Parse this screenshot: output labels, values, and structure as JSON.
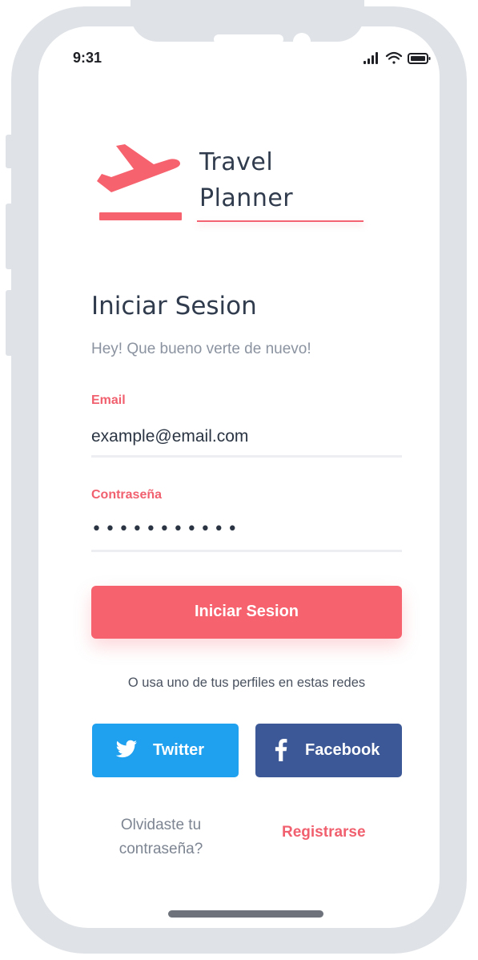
{
  "status_bar": {
    "time": "9:31",
    "signal_icon": "signal-bars-icon",
    "wifi_icon": "wifi-icon",
    "battery_icon": "battery-icon"
  },
  "brand": {
    "logo_icon": "airplane-departure-icon",
    "line1": "Travel",
    "line2": "Planner",
    "accent_color": "#f6626e"
  },
  "login": {
    "title": "Iniciar Sesion",
    "subtitle": "Hey! Que bueno verte de nuevo!",
    "email_label": "Email",
    "email_value": "example@email.com",
    "password_label": "Contraseña",
    "password_value": "•••••••••••",
    "submit_label": "Iniciar Sesion"
  },
  "social": {
    "prompt": "O usa uno de tus perfiles en estas redes",
    "twitter_label": "Twitter",
    "twitter_icon": "twitter-bird-icon",
    "twitter_color": "#1fa1ef",
    "facebook_label": "Facebook",
    "facebook_icon": "facebook-f-icon",
    "facebook_color": "#3c5896"
  },
  "footer": {
    "forgot_line1": "Olvidaste tu",
    "forgot_line2": "contraseña?",
    "register_label": "Registrarse"
  }
}
